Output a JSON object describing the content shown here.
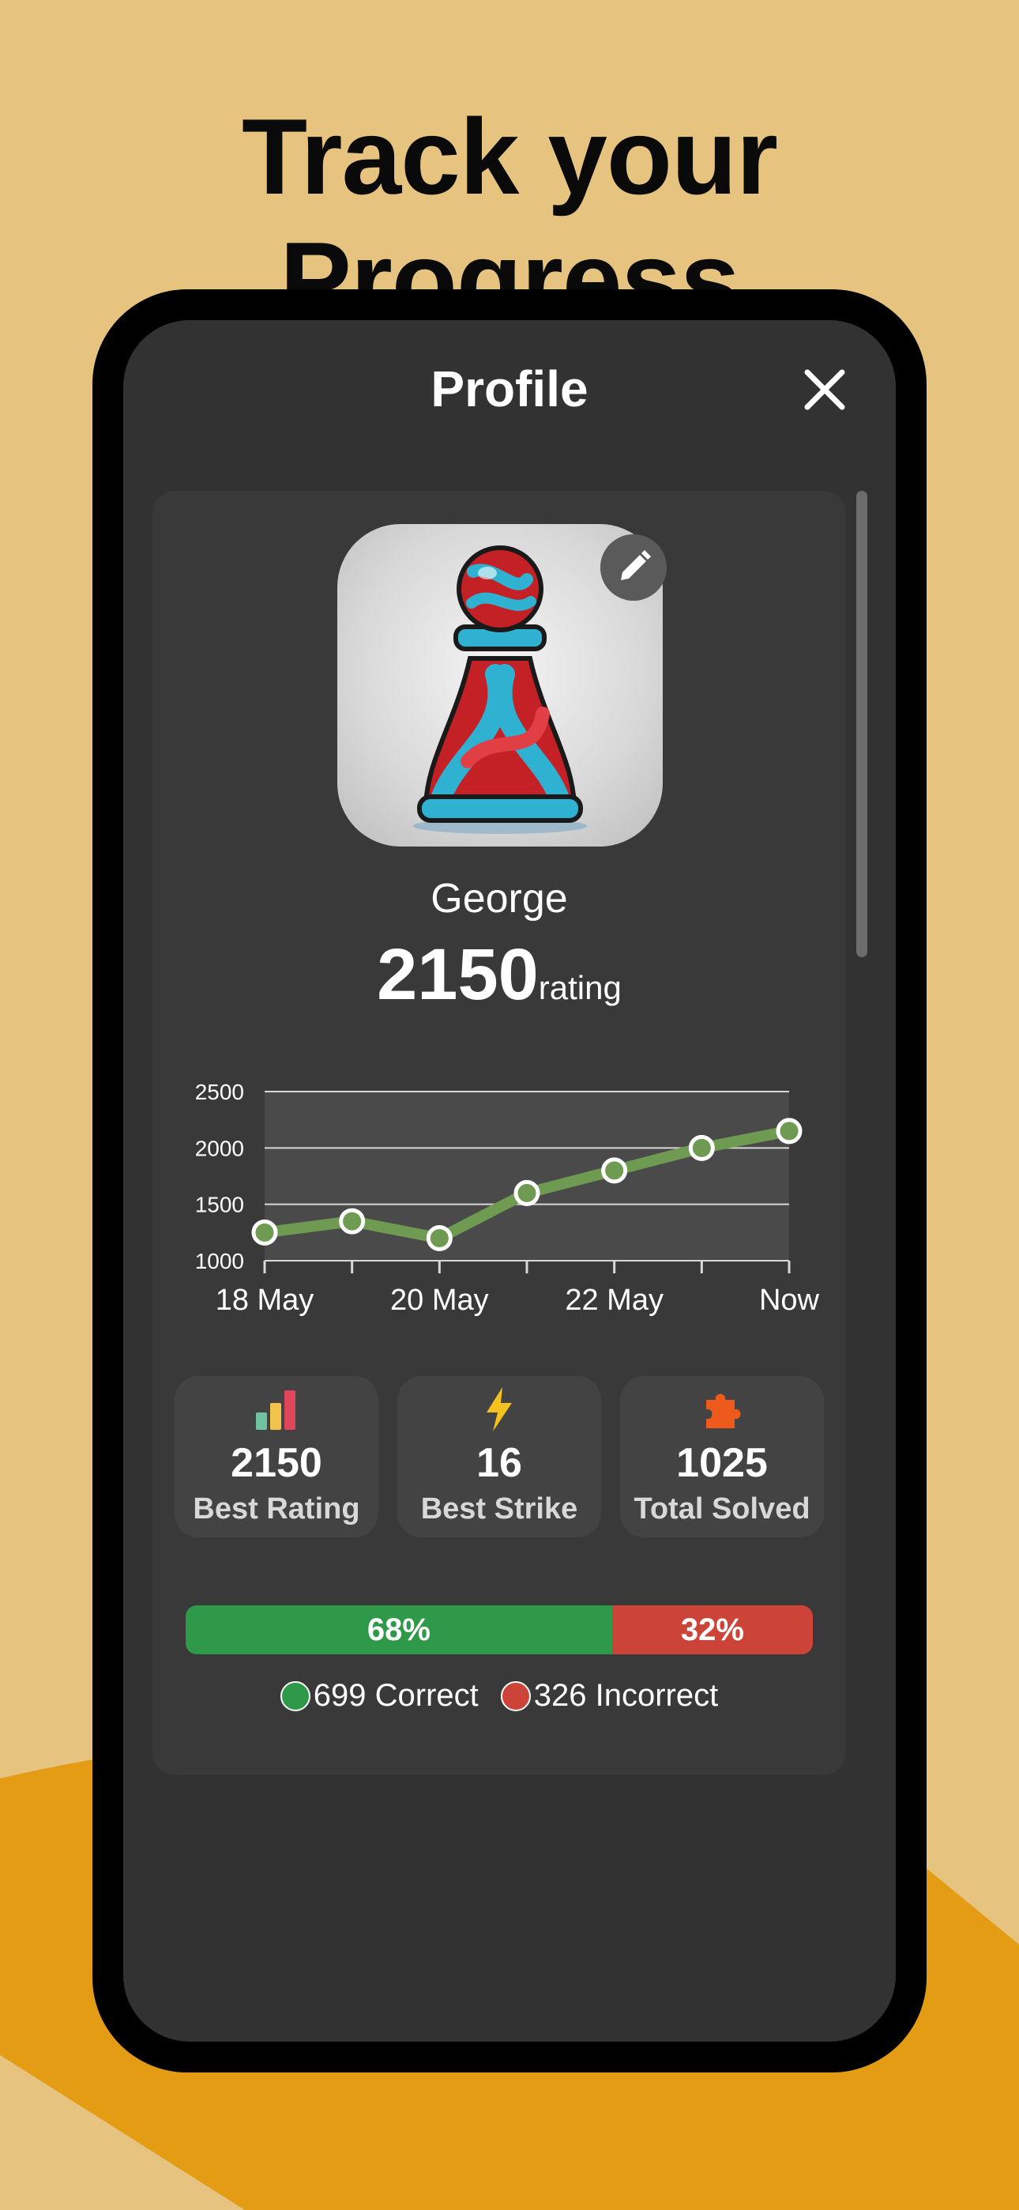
{
  "headline": "Track your Progress",
  "screen": {
    "title": "Profile",
    "close_icon": "close-icon"
  },
  "profile": {
    "avatar_icon": "chess-pawn-avatar",
    "edit_icon": "pencil-icon",
    "name": "George",
    "rating_value": "2150",
    "rating_unit": "rating"
  },
  "chart_data": {
    "type": "line",
    "y_ticks": [
      "2500",
      "2000",
      "1500",
      "1000"
    ],
    "ylim": [
      1000,
      2500
    ],
    "x_tick_labels": [
      "18 May",
      "20 May",
      "22 May",
      "Now"
    ],
    "points": [
      {
        "x": "18 May",
        "y": 1250
      },
      {
        "x": "19 May",
        "y": 1350
      },
      {
        "x": "20 May",
        "y": 1200
      },
      {
        "x": "21 May",
        "y": 1600
      },
      {
        "x": "22 May",
        "y": 1800
      },
      {
        "x": "23 May",
        "y": 2000
      },
      {
        "x": "Now",
        "y": 2150
      }
    ],
    "colors": {
      "line": "#6e9a52",
      "plot_bg": "#4a4a4a",
      "grid": "#d8d8d8"
    },
    "grid": true
  },
  "stats": [
    {
      "icon": "bar-chart-icon",
      "value": "2150",
      "label": "Best Rating"
    },
    {
      "icon": "lightning-icon",
      "value": "16",
      "label": "Best Strike"
    },
    {
      "icon": "puzzle-icon",
      "value": "1025",
      "label": "Total Solved"
    }
  ],
  "accuracy": {
    "correct_percent": 68,
    "incorrect_percent": 32,
    "correct_label": "68%",
    "incorrect_label": "32%",
    "correct_legend": "699 Correct",
    "incorrect_legend": "326 Incorrect",
    "colors": {
      "correct": "#2e9a49",
      "incorrect": "#cc4438"
    }
  }
}
